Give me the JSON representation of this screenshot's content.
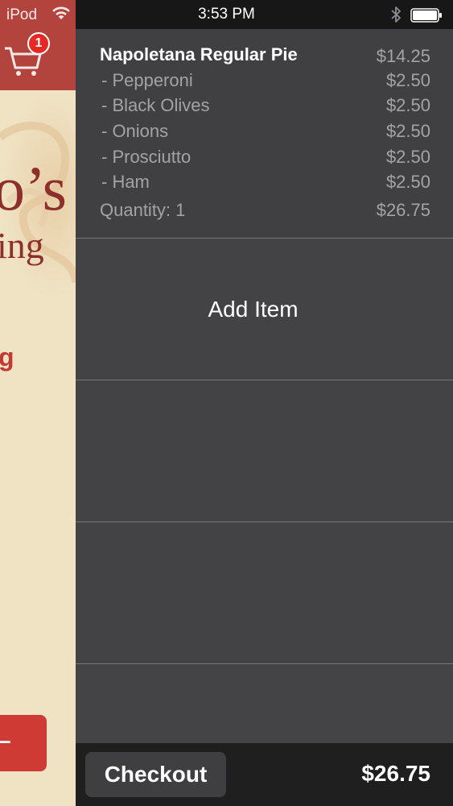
{
  "status_bar": {
    "carrier": "iPod",
    "time": "3:53 PM"
  },
  "background_app": {
    "cart_badge": "1",
    "logo_big": "o’s",
    "logo_small": "ing",
    "section_label": "g"
  },
  "cart": {
    "item": {
      "name": "Napoletana Regular Pie",
      "price": "$14.25"
    },
    "toppings": [
      {
        "name": "- Pepperoni",
        "price": "$2.50"
      },
      {
        "name": "- Black Olives",
        "price": "$2.50"
      },
      {
        "name": "- Onions",
        "price": "$2.50"
      },
      {
        "name": "- Prosciutto",
        "price": "$2.50"
      },
      {
        "name": "- Ham",
        "price": "$2.50"
      }
    ],
    "quantity_label": "Quantity: 1",
    "subtotal": "$26.75",
    "add_item_label": "Add Item"
  },
  "footer": {
    "checkout_label": "Checkout",
    "total": "$26.75"
  },
  "colors": {
    "brand_red": "#b3433d",
    "badge_red": "#e52a24",
    "panel_dark": "#444446",
    "footer_dark": "#1f1f20"
  }
}
